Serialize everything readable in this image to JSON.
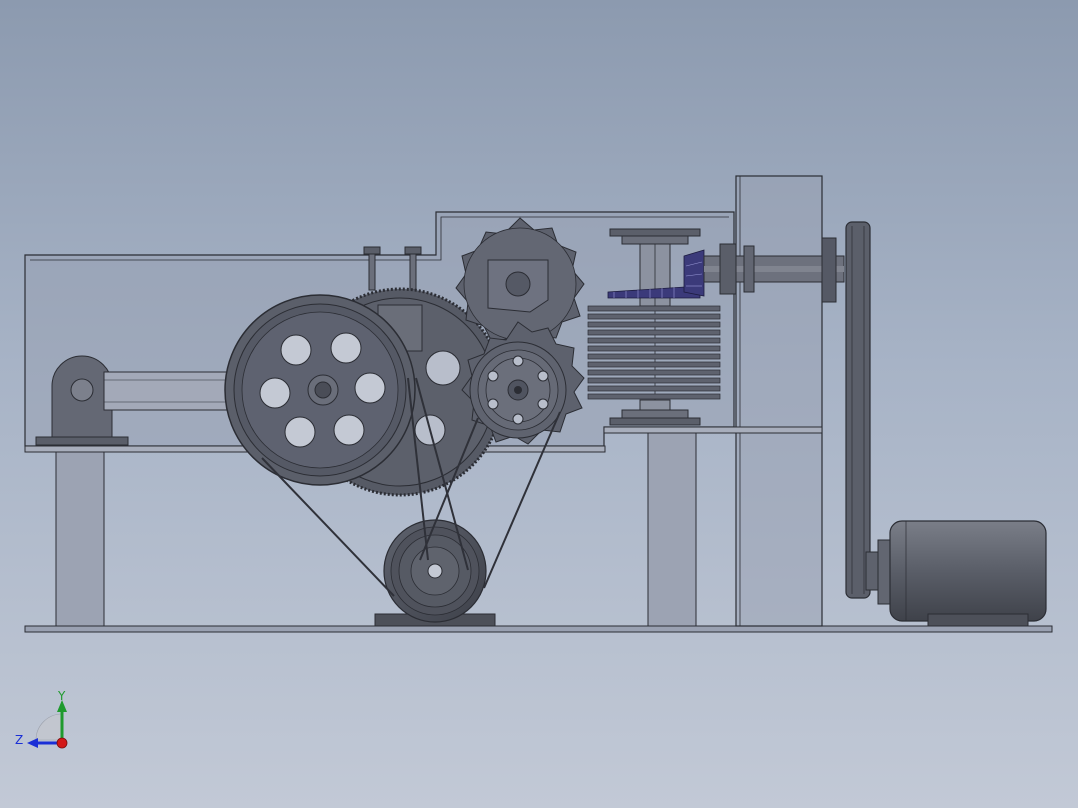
{
  "triad": {
    "y_label": "Y",
    "z_label": "Z",
    "y_color": "#1f9a2e",
    "z_color": "#1a2fd6",
    "x_color": "#d31818"
  },
  "colors": {
    "background_top": "#8c9aaf",
    "background_bottom": "#c2c9d6",
    "metal_dark": "#50545f",
    "metal_mid": "#6b7080",
    "frame_fill": "#98a0b2",
    "edge": "#2b2d34",
    "gear_accent": "#3b3a7a"
  }
}
